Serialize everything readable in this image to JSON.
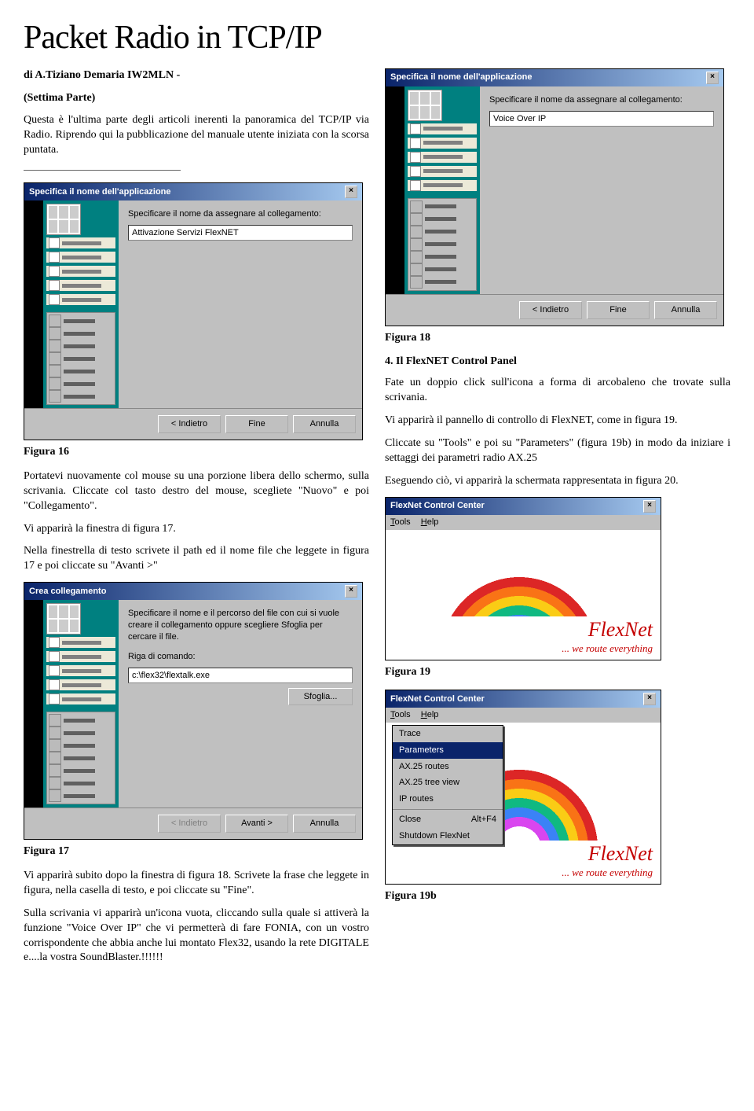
{
  "title_art": "Packet Radio in TCP/IP",
  "byline": "di A.Tiziano Demaria IW2MLN -",
  "part": "(Settima Parte)",
  "para_intro": "Questa è l'ultima parte degli articoli inerenti la panoramica del TCP/IP via Radio. Riprendo qui la pubblicazione del manuale utente iniziata con la scorsa puntata.",
  "para_portatevi": "Portatevi nuovamente col mouse su una porzione libera dello schermo, sulla scrivania. Cliccate col tasto destro del mouse, scegliete \"Nuovo\" e poi \"Collegamento\".",
  "para_vi17": "Vi apparirà la finestra di figura 17.",
  "para_nella": "Nella finestrella di testo scrivete il path ed il nome file che leggete in figura 17 e poi cliccate su \"Avanti >\"",
  "para_fig17_a": "Vi apparirà subito dopo la finestra di figura 18. Scrivete la frase che leggete in figura, nella casella di testo, e poi cliccate su \"Fine\".",
  "para_fig17_b": "Sulla scrivania vi apparirà un'icona vuota, cliccando sulla quale si attiverà la funzione \"Voice Over IP\" che vi permetterà di fare FONIA, con un vostro corrispondente che abbia anche lui montato Flex32, usando la rete DIGITALE e....la vostra SoundBlaster.!!!!!!",
  "sect4": "4.    Il FlexNET Control Panel",
  "para_fate": "Fate un doppio click sull'icona a forma di arcobaleno che trovate sulla scrivania.",
  "para_pannello": "Vi apparirà il pannello di controllo di FlexNET, come in figura 19.",
  "para_cliccate": "Cliccate su \"Tools\" e poi su \"Parameters\" (figura 19b) in modo da iniziare i settaggi dei parametri radio AX.25",
  "para_eseguendo": "Eseguendo ciò, vi apparirà la schermata rappresentata in figura 20.",
  "fig16": "Figura 16",
  "fig17": "Figura 17",
  "fig18": "Figura 18",
  "fig19": "Figura 19",
  "fig19b": "Figura 19b",
  "dialog16": {
    "title": "Specifica il nome dell'applicazione",
    "label": "Specificare il nome da assegnare al collegamento:",
    "value": "Attivazione Servizi FlexNET",
    "btn_indietro": "< Indietro",
    "btn_fine": "Fine",
    "btn_annulla": "Annulla"
  },
  "dialog17": {
    "title": "Crea collegamento",
    "label1": "Specificare il nome e il percorso del file con cui si vuole creare il collegamento oppure scegliere Sfoglia per cercare il file.",
    "label2": "Riga di comando:",
    "value": "c:\\flex32\\flextalk.exe",
    "btn_sfoglia": "Sfoglia...",
    "btn_indietro": "< Indietro",
    "btn_avanti": "Avanti >",
    "btn_annulla": "Annulla"
  },
  "dialog18": {
    "title": "Specifica il nome dell'applicazione",
    "label": "Specificare il nome da assegnare al collegamento:",
    "value": "Voice Over IP",
    "btn_indietro": "< Indietro",
    "btn_fine": "Fine",
    "btn_annulla": "Annulla"
  },
  "flexnet": {
    "title": "FlexNet Control Center",
    "menu_tools": "Tools",
    "menu_help": "Help",
    "brand": "FlexNet",
    "slogan": "... we route everything",
    "menu": {
      "trace": "Trace",
      "parameters": "Parameters",
      "ax25routes": "AX.25 routes",
      "ax25tree": "AX.25 tree view",
      "iproutes": "IP routes",
      "close": "Close",
      "close_key": "Alt+F4",
      "shutdown": "Shutdown FlexNet"
    }
  }
}
